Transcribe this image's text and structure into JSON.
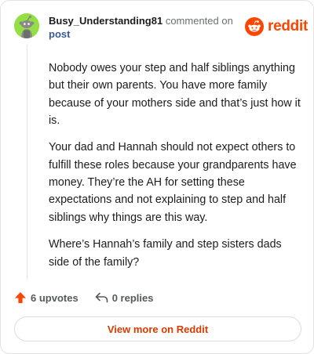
{
  "header": {
    "username": "Busy_Understanding81",
    "action_text": "commented on",
    "post_label": "post",
    "brand_name": "reddit"
  },
  "comment": {
    "paragraphs": [
      "Nobody owes your step and half siblings anything but their own parents. You have more family because of your mothers side and that’s just how it is.",
      "Your dad and Hannah should not expect others to fulfill these roles because your grandparents have money. They’re the AH for setting these expectations and not explaining to step and half siblings why things are this way.",
      "Where’s Hannah’s family and step sisters dads side of the family?"
    ]
  },
  "footer": {
    "upvotes_label": "6 upvotes",
    "replies_label": "0 replies",
    "view_more_label": "View more on Reddit"
  },
  "colors": {
    "brand": "#ff4500",
    "avatar_bg": "#94e044",
    "link": "#3a5b95",
    "cta_text": "#d93a00"
  },
  "icons": {
    "avatar": "snoo-avatar-icon",
    "brand": "reddit-logo-icon",
    "upvote": "upvote-arrow-icon",
    "reply": "reply-arrow-icon"
  }
}
